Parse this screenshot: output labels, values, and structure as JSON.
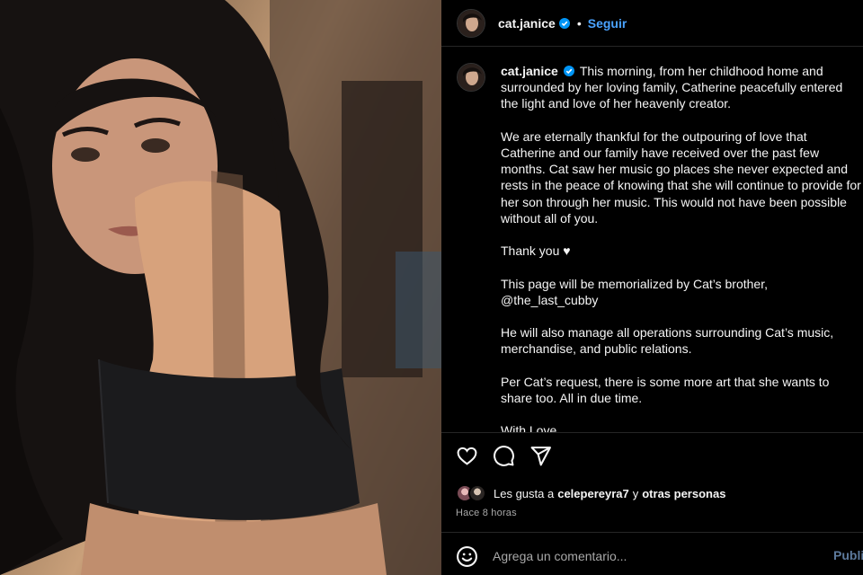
{
  "post_header": {
    "username": "cat.janice",
    "verified_icon": "verified-badge-icon",
    "separator": "•",
    "follow_label": "Seguir"
  },
  "caption": {
    "username": "cat.janice",
    "paragraphs": [
      "This morning, from her childhood home and surrounded by her loving family, Catherine peacefully entered the light and love of her heavenly creator.",
      "We are eternally thankful for the outpouring of love that Catherine and our family have received over the past few months. Cat saw her music go places she never expected and rests in the peace of knowing that she will continue to provide for her son through her music. This would not have been possible without all of you.",
      "Thank you ♥",
      "This page will be memorialized by Cat’s brother, @the_last_cubby",
      "He will also manage all operations surrounding Cat’s music, merchandise, and public relations.",
      "Per Cat’s request, there is some more art that she wants to share too. All in due time.",
      "With Love"
    ]
  },
  "actions": {
    "like_icon": "heart-icon",
    "comment_icon": "comment-icon",
    "share_icon": "send-icon"
  },
  "likes": {
    "prefix": "Les gusta a",
    "user": "celepereyra7",
    "connector": "y",
    "others": "otras personas"
  },
  "timestamp": "Hace 8 horas",
  "comment": {
    "emoji_icon": "smile-icon",
    "placeholder": "Agrega un comentario...",
    "publish_label": "Publicar"
  },
  "colors": {
    "background": "#000000",
    "text": "#f5f5f5",
    "secondary_text": "#a8a8a8",
    "follow_blue": "#4aa3ff",
    "verified_blue": "#0095f6",
    "divider": "#262626"
  }
}
